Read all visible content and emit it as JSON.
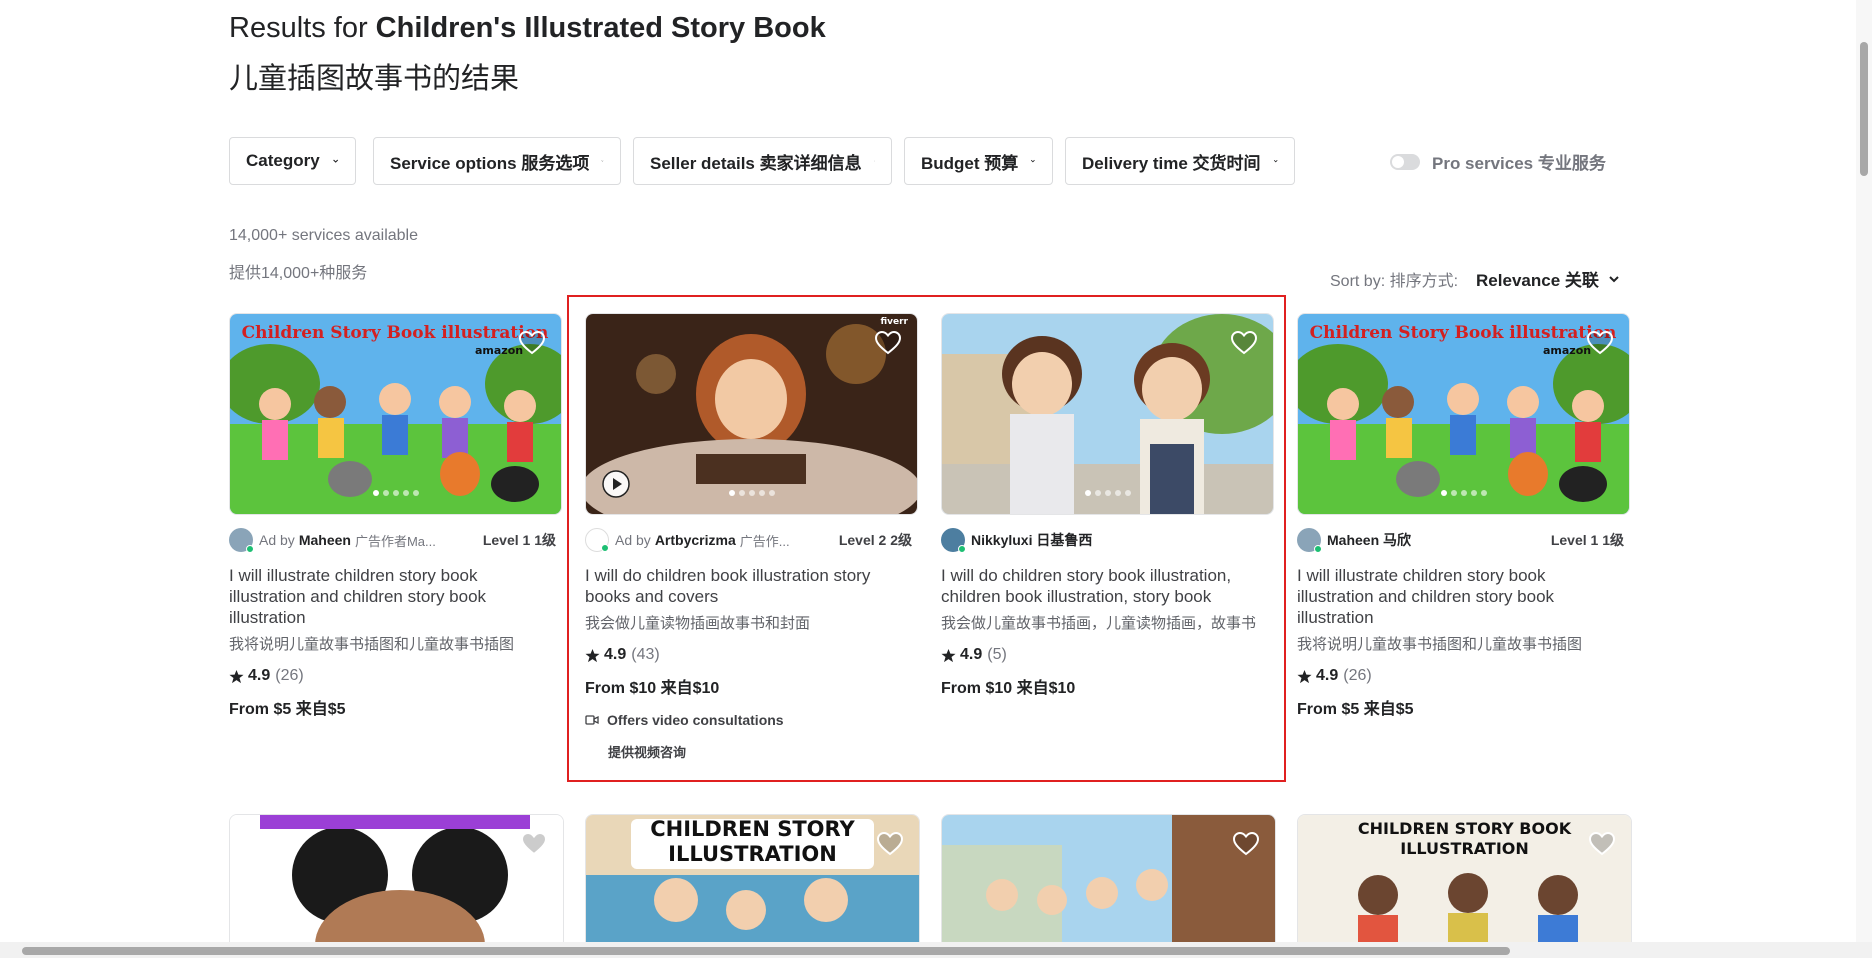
{
  "header": {
    "title_prefix": "Results for ",
    "title_query": "Children's Illustrated Story Book",
    "title_zh": "儿童插图故事书的结果"
  },
  "filters": [
    {
      "label": "Category"
    },
    {
      "label": "Service options 服务选项"
    },
    {
      "label": "Seller details 卖家详细信息"
    },
    {
      "label": "Budget 预算"
    },
    {
      "label": "Delivery time 交货时间"
    }
  ],
  "pro_services": {
    "label": "Pro services 专业服务",
    "enabled": false
  },
  "results": {
    "count_en": "14,000+ services available",
    "count_zh": "提供14,000+种服务"
  },
  "sort": {
    "label": "Sort by: 排序方式:",
    "value": "Relevance 关联"
  },
  "cards": [
    {
      "ad_label": "Ad by",
      "seller": "Maheen",
      "seller_extra": "广告作者Ma...",
      "level": "Level 1 1级",
      "title": "I will illustrate children story book illustration and children story book illustration",
      "title_zh": "我将说明儿童故事书插图和儿童故事书插图",
      "rating": "4.9",
      "reviews": "(26)",
      "price": "From $5 来自$5",
      "image_text": [
        "Children Story Book illustration",
        "amazon"
      ]
    },
    {
      "ad_label": "Ad by",
      "seller": "Artbycrizma",
      "seller_extra": "广告作...",
      "level": "Level 2 2级",
      "title": "I will do children book illustration story books and covers",
      "title_zh": "我会做儿童读物插画故事书和封面",
      "rating": "4.9",
      "reviews": "(43)",
      "price": "From $10 来自$10",
      "video": "Offers video consultations",
      "video_zh": "提供视频咨询",
      "image_text": [
        "fiverr"
      ]
    },
    {
      "ad_label": "",
      "seller": "Nikkyluxi 日基鲁西",
      "seller_extra": "",
      "level": "",
      "title": "I will do children story book illustration, children book illustration, story book",
      "title_zh": "我会做儿童故事书插画，儿童读物插画，故事书",
      "rating": "4.9",
      "reviews": "(5)",
      "price": "From $10 来自$10"
    },
    {
      "ad_label": "",
      "seller": "Maheen 马欣",
      "seller_extra": "",
      "level": "Level 1 1级",
      "title": "I will illustrate children story book illustration and children story book illustration",
      "title_zh": "我将说明儿童故事书插图和儿童故事书插图",
      "rating": "4.9",
      "reviews": "(26)",
      "price": "From $5 来自$5",
      "image_text": [
        "Children Story Book illustration",
        "amazon"
      ]
    }
  ],
  "row2": [
    {
      "banner": ""
    },
    {
      "banner": "CHILDREN STORY ILLUSTRATION"
    },
    {
      "banner": ""
    },
    {
      "banner": "CHILDREN STORY BOOK ILLUSTRATION"
    }
  ],
  "colors": {
    "highlight": "#e02020",
    "online": "#1dbf73",
    "text": "#222325",
    "muted": "#74767e"
  },
  "icons": [
    "chevron-down-icon",
    "heart-icon",
    "play-icon",
    "star-icon",
    "video-icon"
  ]
}
